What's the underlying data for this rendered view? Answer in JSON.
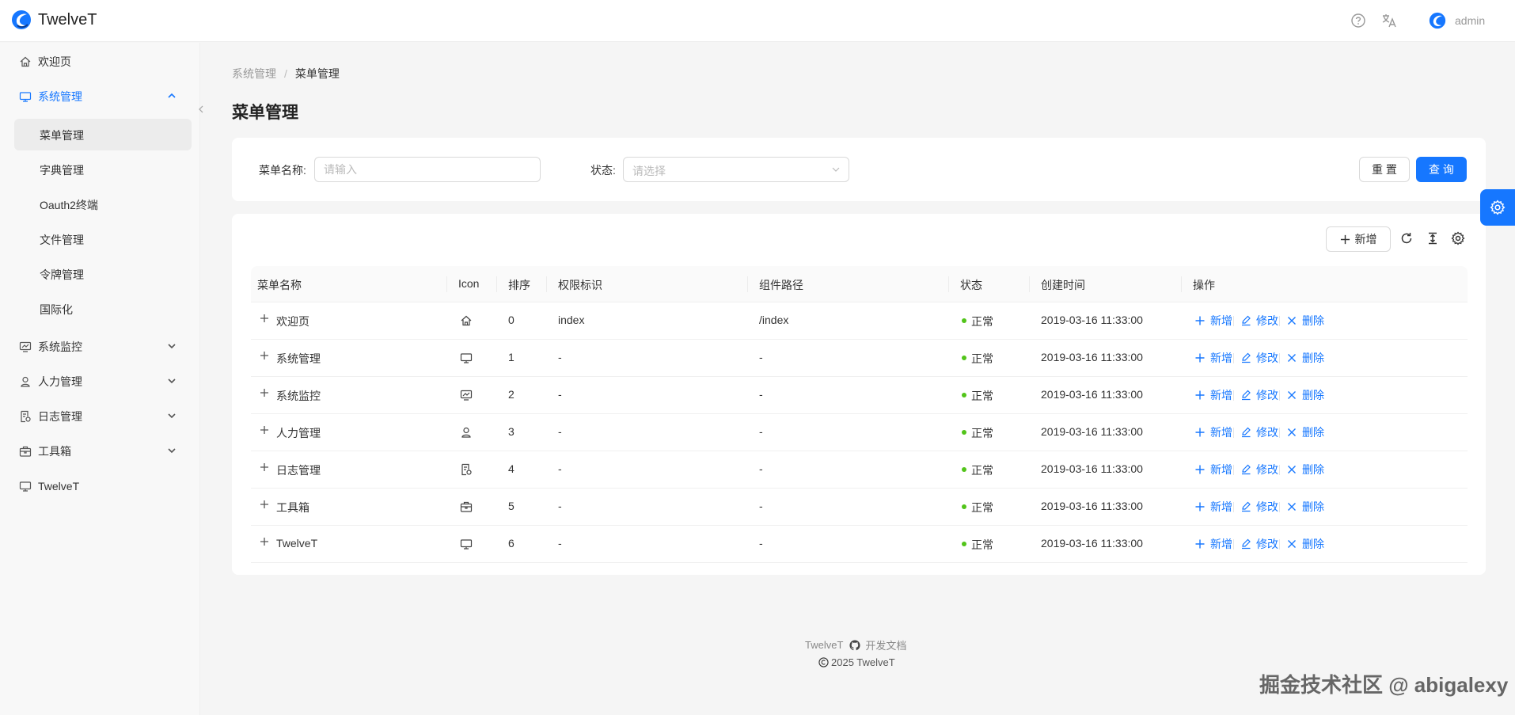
{
  "header": {
    "app_title": "TwelveT",
    "username": "admin",
    "brand_color": "#1677ff"
  },
  "sidebar": {
    "items": [
      {
        "label": "欢迎页",
        "icon": "home-icon"
      },
      {
        "label": "系统管理",
        "icon": "monitor-icon",
        "expanded": true
      },
      {
        "label": "系统监控",
        "icon": "chart-monitor-icon"
      },
      {
        "label": "人力管理",
        "icon": "person-icon"
      },
      {
        "label": "日志管理",
        "icon": "log-icon"
      },
      {
        "label": "工具箱",
        "icon": "toolbox-icon"
      },
      {
        "label": "TwelveT",
        "icon": "monitor-icon"
      }
    ],
    "sub_items": [
      "菜单管理",
      "字典管理",
      "Oauth2终端",
      "文件管理",
      "令牌管理",
      "国际化"
    ],
    "selected_sub": "菜单管理"
  },
  "breadcrumb": {
    "parent": "系统管理",
    "separator": "/",
    "current": "菜单管理"
  },
  "page_title": "菜单管理",
  "search": {
    "name_label": "菜单名称:",
    "name_placeholder": "请输入",
    "status_label": "状态:",
    "status_placeholder": "请选择",
    "reset_label": "重 置",
    "query_label": "查 询"
  },
  "toolbar": {
    "add_label": "新增"
  },
  "table": {
    "columns": [
      "菜单名称",
      "Icon",
      "排序",
      "权限标识",
      "组件路径",
      "状态",
      "创建时间",
      "操作"
    ],
    "rows": [
      {
        "name": "欢迎页",
        "icon": "home-icon",
        "order": "0",
        "perm": "index",
        "path": "/index",
        "status": "正常",
        "created": "2019-03-16 11:33:00"
      },
      {
        "name": "系统管理",
        "icon": "monitor-icon",
        "order": "1",
        "perm": "-",
        "path": "-",
        "status": "正常",
        "created": "2019-03-16 11:33:00"
      },
      {
        "name": "系统监控",
        "icon": "chart-monitor-icon",
        "order": "2",
        "perm": "-",
        "path": "-",
        "status": "正常",
        "created": "2019-03-16 11:33:00"
      },
      {
        "name": "人力管理",
        "icon": "person-icon",
        "order": "3",
        "perm": "-",
        "path": "-",
        "status": "正常",
        "created": "2019-03-16 11:33:00"
      },
      {
        "name": "日志管理",
        "icon": "log-icon",
        "order": "4",
        "perm": "-",
        "path": "-",
        "status": "正常",
        "created": "2019-03-16 11:33:00"
      },
      {
        "name": "工具箱",
        "icon": "toolbox-icon",
        "order": "5",
        "perm": "-",
        "path": "-",
        "status": "正常",
        "created": "2019-03-16 11:33:00"
      },
      {
        "name": "TwelveT",
        "icon": "monitor-icon",
        "order": "6",
        "perm": "-",
        "path": "-",
        "status": "正常",
        "created": "2019-03-16 11:33:00"
      }
    ],
    "actions": {
      "add": "新增",
      "edit": "修改",
      "delete": "删除"
    },
    "status_color": "#52c41a"
  },
  "footer": {
    "brand": "TwelveT",
    "docs_label": "开发文档",
    "copyright": "2025 TwelveT"
  },
  "watermark": "掘金技术社区 @ abigalexy"
}
